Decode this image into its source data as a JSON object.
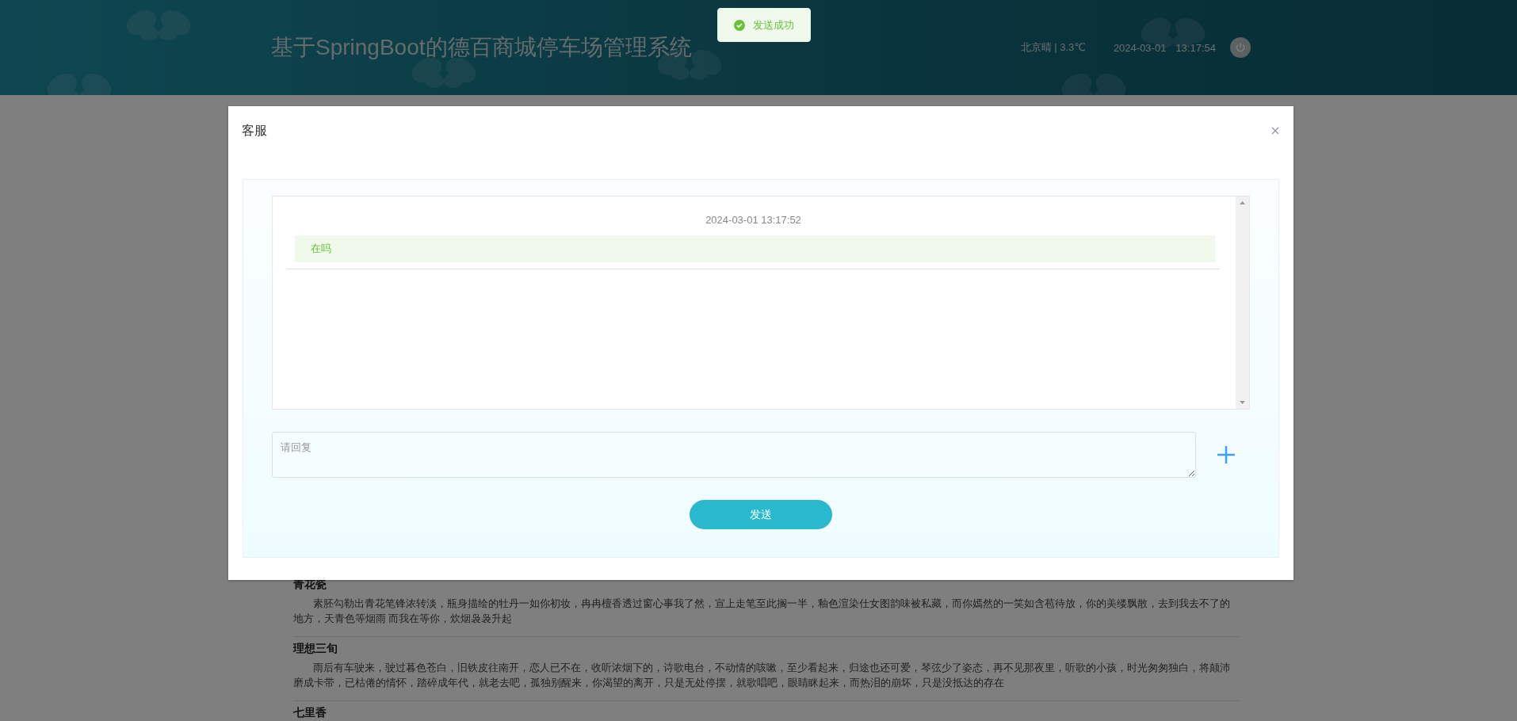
{
  "header": {
    "title": "基于SpringBoot的德百商城停车场管理系统",
    "weather": "北京晴 | 3.3℃",
    "date": "2024-03-01",
    "time": "13:17:54"
  },
  "toast": {
    "kind": "success",
    "text": "发送成功"
  },
  "dialog": {
    "title": "客服",
    "messages": [
      {
        "time": "2024-03-01 13:17:52",
        "text": "在吗"
      }
    ],
    "reply": {
      "placeholder": "请回复"
    },
    "send_button": "发送"
  },
  "articles": [
    {
      "title": "青花瓷",
      "body": "素胚勾勒出青花笔锋浓转淡，瓶身描绘的牡丹一如你初妆，冉冉檀香透过窗心事我了然，宣上走笔至此搁一半，釉色渲染仕女图韵味被私藏，而你嫣然的一笑如含苞待放，你的美缕飘散，去到我去不了的地方，天青色等烟雨 而我在等你，炊烟袅袅升起"
    },
    {
      "title": "理想三旬",
      "body": "雨后有车驶来，驶过暮色苍白，旧铁皮往南开，恋人已不在，收听浓烟下的，诗歌电台，不动情的咳嗽，至少看起来，归途也还可爱，琴弦少了姿态，再不见那夜里，听歌的小孩，时光匆匆独白，将颠沛磨成卡带，已枯倦的情怀，踏碎成年代，就老去吧，孤独别醒来，你渴望的离开，只是无处停摆，就歌唱吧，眼睛眯起来，而热泪的崩坏，只是没抵达的存在"
    },
    {
      "title": "七里香"
    }
  ]
}
